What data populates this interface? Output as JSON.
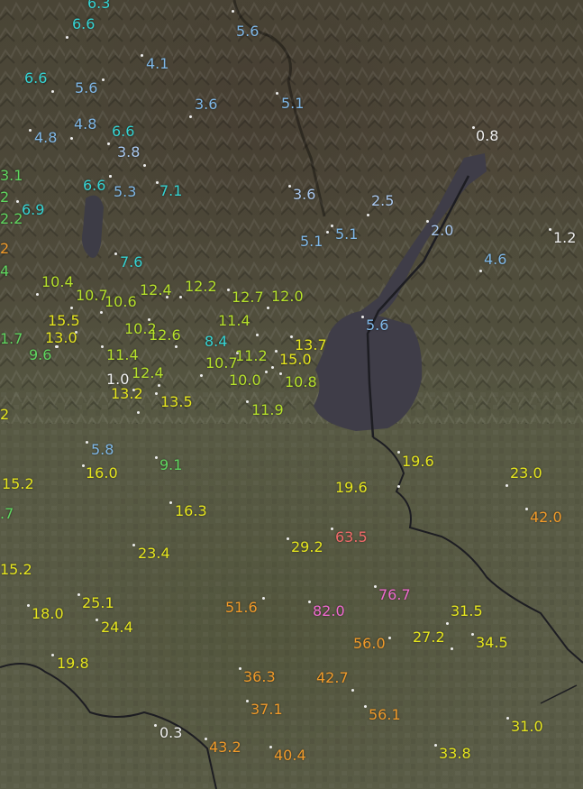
{
  "map": {
    "colors": {
      "blue": "#7fb8e8",
      "lightblue": "#a9c8f0",
      "cyan": "#35d4d4",
      "green": "#5fd65f",
      "yellowgreen": "#b6e22b",
      "yellow": "#e6e61e",
      "orange": "#f09a2a",
      "red": "#f06a6a",
      "pink": "#f06ad0",
      "white": "#f0f0f0"
    },
    "stations": [
      {
        "v": "6.3",
        "c": "cyan"
      },
      {
        "v": "6.6",
        "c": "cyan"
      },
      {
        "v": "5.6",
        "c": "blue"
      },
      {
        "v": "4.1",
        "c": "blue"
      },
      {
        "v": "6.6",
        "c": "cyan"
      },
      {
        "v": "5.6",
        "c": "blue"
      },
      {
        "v": "3.6",
        "c": "blue"
      },
      {
        "v": "5.1",
        "c": "blue"
      },
      {
        "v": "4.8",
        "c": "blue"
      },
      {
        "v": "4.8",
        "c": "blue"
      },
      {
        "v": "6.6",
        "c": "cyan"
      },
      {
        "v": "3.8",
        "c": "lightblue"
      },
      {
        "v": "0.8",
        "c": "white"
      },
      {
        "v": "3.1",
        "c": "green"
      },
      {
        "v": "6.6",
        "c": "cyan"
      },
      {
        "v": "5.3",
        "c": "blue"
      },
      {
        "v": "7.1",
        "c": "cyan"
      },
      {
        "v": "3.6",
        "c": "lightblue"
      },
      {
        "v": "2.5",
        "c": "lightblue"
      },
      {
        "v": "2",
        "c": "green"
      },
      {
        "v": "6.9",
        "c": "cyan"
      },
      {
        "v": "2.2",
        "c": "green"
      },
      {
        "v": "2.0",
        "c": "lightblue"
      },
      {
        "v": "5.1",
        "c": "blue"
      },
      {
        "v": "5.1",
        "c": "blue"
      },
      {
        "v": "1.2",
        "c": "white"
      },
      {
        "v": "2",
        "c": "orange"
      },
      {
        "v": "4.6",
        "c": "blue"
      },
      {
        "v": "7.6",
        "c": "cyan"
      },
      {
        "v": "4",
        "c": "green"
      },
      {
        "v": "10.4",
        "c": "yellowgreen"
      },
      {
        "v": "12.4",
        "c": "yellowgreen"
      },
      {
        "v": "12.2",
        "c": "yellowgreen"
      },
      {
        "v": "10.7",
        "c": "yellowgreen"
      },
      {
        "v": "12.7",
        "c": "yellowgreen"
      },
      {
        "v": "12.0",
        "c": "yellowgreen"
      },
      {
        "v": "10.6",
        "c": "yellowgreen"
      },
      {
        "v": "15.5",
        "c": "yellow"
      },
      {
        "v": "11.4",
        "c": "yellowgreen"
      },
      {
        "v": "5.6",
        "c": "blue"
      },
      {
        "v": "10.2",
        "c": "yellowgreen"
      },
      {
        "v": "12.6",
        "c": "yellowgreen"
      },
      {
        "v": "1.7",
        "c": "green"
      },
      {
        "v": "13.0",
        "c": "yellow"
      },
      {
        "v": "8.4",
        "c": "cyan"
      },
      {
        "v": "13.7",
        "c": "yellow"
      },
      {
        "v": "11.2",
        "c": "yellowgreen"
      },
      {
        "v": "9.6",
        "c": "green"
      },
      {
        "v": "11.4",
        "c": "yellowgreen"
      },
      {
        "v": "15.0",
        "c": "yellow"
      },
      {
        "v": "10.7",
        "c": "yellowgreen"
      },
      {
        "v": "1.0",
        "c": "white"
      },
      {
        "v": "12.4",
        "c": "yellowgreen"
      },
      {
        "v": "10.0",
        "c": "yellowgreen"
      },
      {
        "v": "10.8",
        "c": "yellowgreen"
      },
      {
        "v": "13.2",
        "c": "yellow"
      },
      {
        "v": "13.5",
        "c": "yellow"
      },
      {
        "v": "2",
        "c": "yellow"
      },
      {
        "v": "11.9",
        "c": "yellowgreen"
      },
      {
        "v": "5.8",
        "c": "blue"
      },
      {
        "v": "19.6",
        "c": "yellow"
      },
      {
        "v": "23.0",
        "c": "yellow"
      },
      {
        "v": "16.0",
        "c": "yellow"
      },
      {
        "v": "9.1",
        "c": "green"
      },
      {
        "v": "15.2",
        "c": "yellow"
      },
      {
        "v": "19.6",
        "c": "yellow"
      },
      {
        "v": "42.0",
        "c": "orange"
      },
      {
        "v": ".7",
        "c": "green"
      },
      {
        "v": "16.3",
        "c": "yellow"
      },
      {
        "v": "63.5",
        "c": "red"
      },
      {
        "v": "23.4",
        "c": "yellow"
      },
      {
        "v": "29.2",
        "c": "yellow"
      },
      {
        "v": "15.2",
        "c": "yellow"
      },
      {
        "v": "76.7",
        "c": "pink"
      },
      {
        "v": "25.1",
        "c": "yellow"
      },
      {
        "v": "51.6",
        "c": "orange"
      },
      {
        "v": "82.0",
        "c": "pink"
      },
      {
        "v": "31.5",
        "c": "yellow"
      },
      {
        "v": "18.0",
        "c": "yellow"
      },
      {
        "v": "24.4",
        "c": "yellow"
      },
      {
        "v": "27.2",
        "c": "yellow"
      },
      {
        "v": "56.0",
        "c": "orange"
      },
      {
        "v": "34.5",
        "c": "yellow"
      },
      {
        "v": "19.8",
        "c": "yellow"
      },
      {
        "v": "36.3",
        "c": "orange"
      },
      {
        "v": "42.7",
        "c": "orange"
      },
      {
        "v": "37.1",
        "c": "orange"
      },
      {
        "v": "56.1",
        "c": "orange"
      },
      {
        "v": "0.3",
        "c": "white"
      },
      {
        "v": "31.0",
        "c": "yellow"
      },
      {
        "v": "43.2",
        "c": "orange"
      },
      {
        "v": "40.4",
        "c": "orange"
      },
      {
        "v": "33.8",
        "c": "yellow"
      }
    ]
  }
}
